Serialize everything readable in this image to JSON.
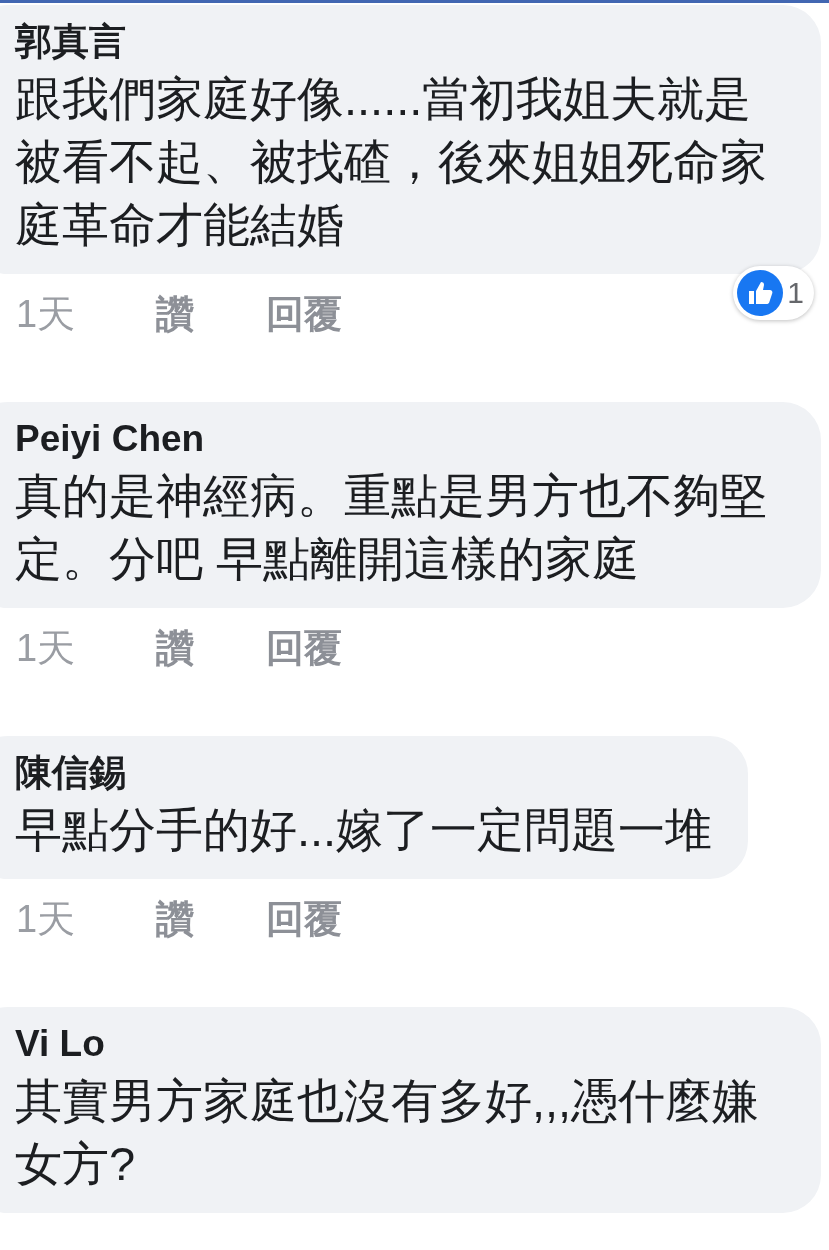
{
  "comments": [
    {
      "author": "郭真言",
      "text": "跟我們家庭好像......當初我姐夫就是被看不起、被找碴，後來姐姐死命家庭革命才能結婚",
      "meta": {
        "time": "1天",
        "like": "讚",
        "reply": "回覆"
      },
      "reactions": {
        "count": "1"
      }
    },
    {
      "author": "Peiyi Chen",
      "text": "真的是神經病。重點是男方也不夠堅定。分吧 早點離開這樣的家庭",
      "meta": {
        "time": "1天",
        "like": "讚",
        "reply": "回覆"
      }
    },
    {
      "author": "陳信錫",
      "text": "早點分手的好...嫁了一定問題一堆",
      "meta": {
        "time": "1天",
        "like": "讚",
        "reply": "回覆"
      }
    },
    {
      "author": "Vi Lo",
      "text": "其實男方家庭也沒有多好,,,憑什麼嫌女方?"
    }
  ]
}
